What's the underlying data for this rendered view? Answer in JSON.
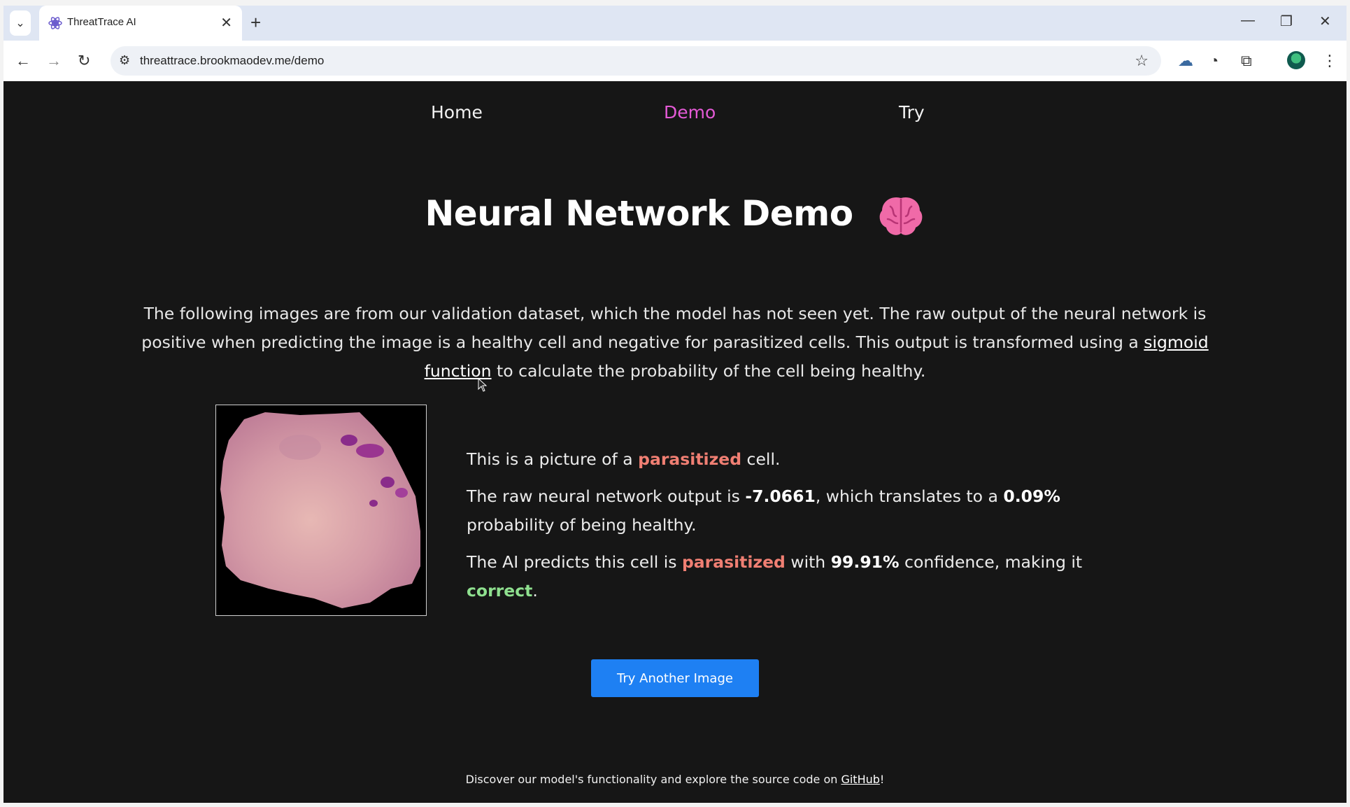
{
  "browser": {
    "tab_title": "ThreatTrace AI",
    "url": "threattrace.brookmaodev.me/demo",
    "new_tab_glyph": "+",
    "close_glyph": "✕"
  },
  "nav": {
    "home": "Home",
    "demo": "Demo",
    "try": "Try",
    "active": "Demo"
  },
  "main": {
    "title": "Neural Network Demo",
    "intro_part1": "The following images are from our validation dataset, which the model has not seen yet. The raw output of the neural network is positive when predicting the image is a healthy cell and negative for parasitized cells. This output is transformed using a ",
    "intro_link": "sigmoid function",
    "intro_part2": " to calculate the probability of the cell being healthy.",
    "result": {
      "line1_pre": "This is a picture of a ",
      "label": "parasitized",
      "line1_post": " cell.",
      "line2_pre": "The raw neural network output is ",
      "raw_output": "-7.0661",
      "line2_mid": ", which translates to a ",
      "probability": "0.09%",
      "line2_post": " probability of being healthy.",
      "line3_pre": "The AI predicts this cell is ",
      "predicted": "parasitized",
      "line3_mid": " with ",
      "confidence": "99.91%",
      "line3_mid2": " confidence, making it ",
      "verdict": "correct",
      "line3_post": "."
    },
    "button_label": "Try Another Image"
  },
  "footer": {
    "text_pre": "Discover our model's functionality and explore the source code on ",
    "link": "GitHub",
    "text_post": "!"
  },
  "colors": {
    "accent_nav": "#e45ad6",
    "parasitized": "#f07f73",
    "correct": "#8fe08f",
    "button": "#1e80f3",
    "background": "#161616"
  },
  "icons": [
    "chevron-down-icon",
    "favicon-icon",
    "close-icon",
    "plus-icon",
    "minimize-icon",
    "restore-icon",
    "back-icon",
    "forward-icon",
    "reload-icon",
    "site-info-icon",
    "star-icon",
    "extension-cloud-icon",
    "performance-icon",
    "puzzle-icon",
    "profile-avatar",
    "menu-dots-icon",
    "brain-icon"
  ]
}
